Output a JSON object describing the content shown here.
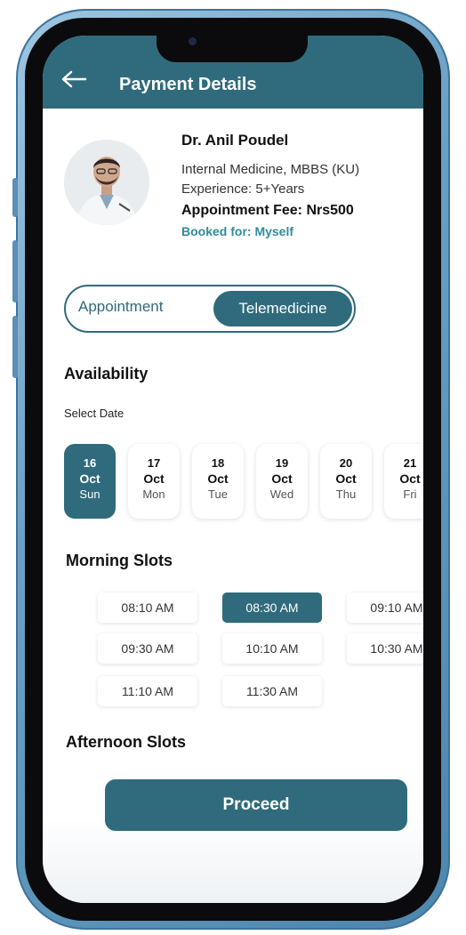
{
  "header": {
    "title": "Payment Details",
    "back_icon": "arrow-left-icon"
  },
  "doctor": {
    "name": "Dr. Anil Poudel",
    "specialty": "Internal Medicine, MBBS (KU)",
    "experience": "Experience: 5+Years",
    "fee": "Appointment Fee: Nrs500",
    "booked_for": "Booked for: Myself"
  },
  "mode_toggle": {
    "options": [
      "Appointment",
      "Telemedicine"
    ],
    "selected": "Telemedicine"
  },
  "availability": {
    "title": "Availability",
    "select_date_label": "Select Date",
    "dates": [
      {
        "day": "16",
        "month": "Oct",
        "weekday": "Sun",
        "selected": true
      },
      {
        "day": "17",
        "month": "Oct",
        "weekday": "Mon",
        "selected": false
      },
      {
        "day": "18",
        "month": "Oct",
        "weekday": "Tue",
        "selected": false
      },
      {
        "day": "19",
        "month": "Oct",
        "weekday": "Wed",
        "selected": false
      },
      {
        "day": "20",
        "month": "Oct",
        "weekday": "Thu",
        "selected": false
      },
      {
        "day": "21",
        "month": "Oct",
        "weekday": "Fri",
        "selected": false
      }
    ]
  },
  "morning": {
    "title": "Morning Slots",
    "slots": [
      "08:10 AM",
      "08:30 AM",
      "09:10 AM",
      "09:30 AM",
      "10:10 AM",
      "10:30 AM",
      "11:10 AM",
      "11:30 AM"
    ],
    "selected": "08:30 AM"
  },
  "afternoon": {
    "title": "Afternoon Slots"
  },
  "proceed_label": "Proceed",
  "colors": {
    "primary": "#2f6b7c",
    "accent_text": "#2f8c9a",
    "frame": "#6aa0c4"
  }
}
